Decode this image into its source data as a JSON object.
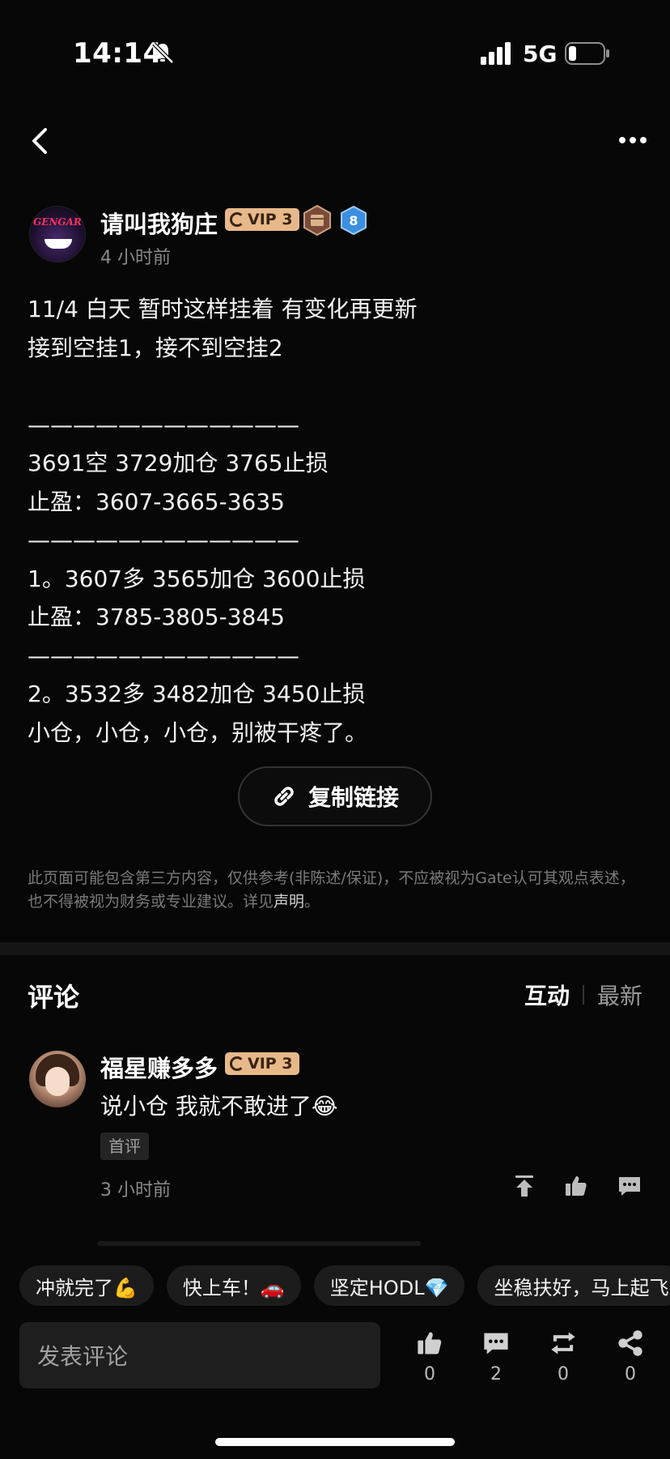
{
  "status_bar": {
    "time": "14:14",
    "network": "5G"
  },
  "author": {
    "name": "请叫我狗庄",
    "vip_label": "VIP 3",
    "level": "8",
    "time": "4 小时前",
    "avatar_text": "GENGAR"
  },
  "post": {
    "text": "11/4 白天 暂时这样挂着 有变化再更新\n接到空挂1，接不到空挂2\n\n————————————\n3691空 3729加仓 3765止损\n止盈：3607-3665-3635\n————————————\n1。3607多 3565加仓  3600止损\n止盈：3785-3805-3845\n————————————\n2。3532多 3482加仓 3450止损\n小仓，小仓，小仓，别被干疼了。"
  },
  "copy_link_label": "复制链接",
  "disclaimer": {
    "text": "此页面可能包含第三方内容，仅供参考(非陈述/保证)，不应被视为Gate认可其观点表述，也不得被视为财务或专业建议。详见",
    "link": "声明",
    "end": "。"
  },
  "comments": {
    "title": "评论",
    "sort_active": "互动",
    "sort_inactive": "最新",
    "items": [
      {
        "name": "福星赚多多",
        "vip_label": "VIP 3",
        "text": "说小仓 我就不敢进了😂",
        "tag": "首评",
        "time": "3 小时前"
      }
    ]
  },
  "quick_replies": [
    "冲就完了💪",
    "快上车！🚗",
    "坚定HODL💎",
    "坐稳扶好，马上起飞"
  ],
  "bottom_bar": {
    "input_placeholder": "发表评论",
    "like_count": "0",
    "comment_count": "2",
    "repost_count": "0",
    "share_count": "0"
  },
  "colors": {
    "background": "#070707",
    "vip": "#e7b98a",
    "level_badge": "#3a8fe0"
  }
}
